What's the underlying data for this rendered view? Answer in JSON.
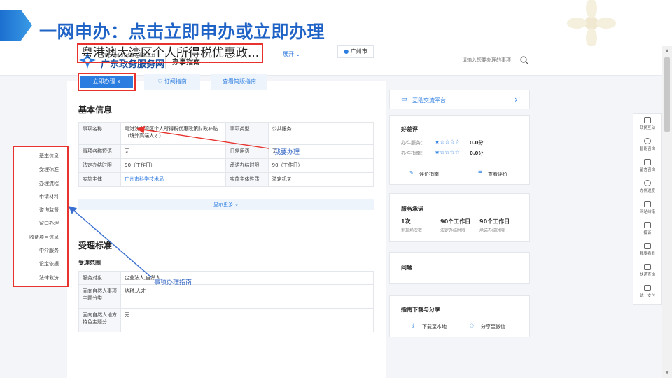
{
  "slide": {
    "heading": "一网申办：点击立即申办或立即办理"
  },
  "header": {
    "logo_small": "全国一体化在线政务服务平台",
    "logo_big": "广东政务服务网",
    "nav_label": "办事指南",
    "search_placeholder": "请输入您要办理的事项"
  },
  "item": {
    "title": "粤港澳大湾区个人所得税优惠政...",
    "expand": "展开 ⌄",
    "city": "广州市"
  },
  "actions": {
    "apply": "立即办理 »",
    "subscribe": "♡  订阅指南",
    "simple": "查看简版指南"
  },
  "annotations": {
    "want_to_apply": "我要办理",
    "guide": "事项办理指南"
  },
  "left_menu": [
    "基本信息",
    "受理标准",
    "办理流程",
    "申请材料",
    "咨询监督",
    "窗口办理",
    "收费项目信息",
    "中介服务",
    "设定依据",
    "法律救济"
  ],
  "basic_info": {
    "heading": "基本信息",
    "rows": [
      [
        "事项名称",
        "粤港澳大湾区个人所得税优惠政策财政补贴（境外高端人才）",
        "事项类型",
        "公共服务"
      ],
      [
        "事项名称短语",
        "无",
        "日常用语",
        "无"
      ],
      [
        "法定办结时限",
        "90（工作日）",
        "承诺办结时限",
        "90（工作日）"
      ],
      [
        "实施主体",
        "广州市科学技术局",
        "实施主体性质",
        "法定机关"
      ]
    ],
    "show_more": "显示更多 ⌄"
  },
  "acceptance": {
    "heading": "受理标准",
    "scope_label": "受理范围",
    "rows": [
      [
        "服务对象",
        "企业法人,自然人"
      ],
      [
        "面向自然人事项主题分类",
        "纳税,人才"
      ],
      [
        "面向自然人地方特色主题分",
        "无"
      ]
    ]
  },
  "right": {
    "platform": "互助交流平台",
    "platform_arrow": "›",
    "rating_title": "好差评",
    "rating_service_label": "办件服务：",
    "rating_service_stars": "★☆☆☆☆",
    "rating_service_score": "0.0分",
    "rating_guide_label": "办件指南：",
    "rating_guide_stars": "★☆☆☆☆",
    "rating_guide_score": "0.0分",
    "rate_guide": "评价指南",
    "view_rating": "查看评价",
    "promise_title": "服务承诺",
    "promise_items": [
      {
        "value": "1次",
        "label": "到现场次数"
      },
      {
        "value": "90个工作日",
        "label": "法定办结时限"
      },
      {
        "value": "90个工作日",
        "label": "承诺办结时限"
      }
    ],
    "faq_title": "问题",
    "download_title": "指南下载与分享",
    "download_local": "下载至本地",
    "share_wechat": "分享至微信"
  },
  "float_bar": [
    "政民互动",
    "智能咨询",
    "留言咨询",
    "办件进度",
    "网站纠错",
    "投诉",
    "我要看看",
    "快递查询",
    "统一支付"
  ],
  "colors": {
    "accent": "#2b7de0",
    "highlight": "#e8322d",
    "heading": "#1f63c6"
  }
}
